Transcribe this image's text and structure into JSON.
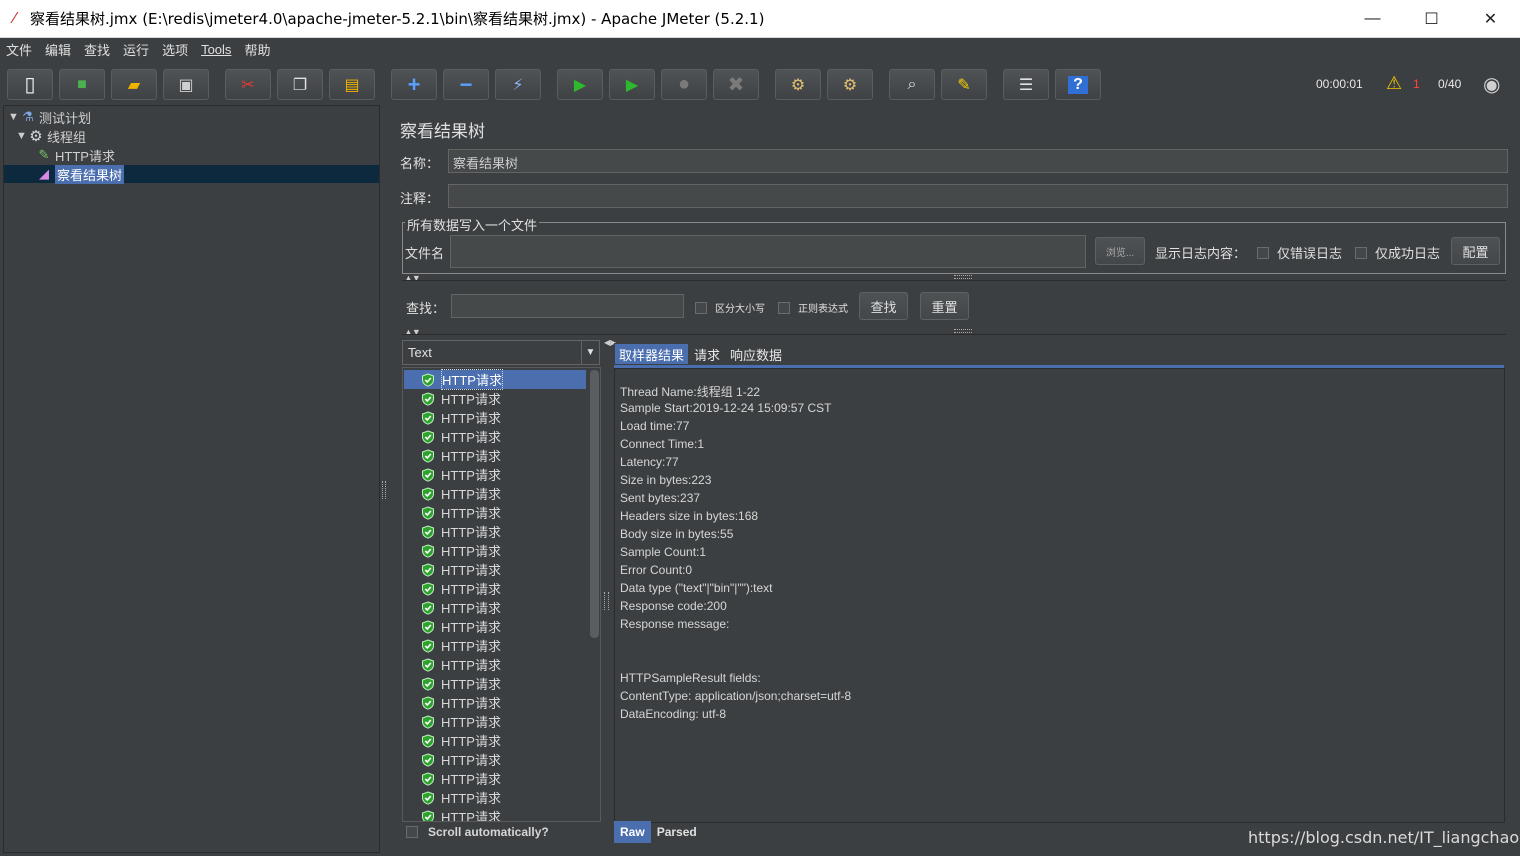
{
  "window": {
    "title": "察看结果树.jmx (E:\\redis\\jmeter4.0\\apache-jmeter-5.2.1\\bin\\察看结果树.jmx) - Apache JMeter (5.2.1)",
    "minimize": "—",
    "maximize": "☐",
    "close": "✕"
  },
  "menu": [
    "文件",
    "编辑",
    "查找",
    "运行",
    "选项",
    "Tools",
    "帮助"
  ],
  "toolbar": {
    "buttons": [
      {
        "name": "new-icon",
        "glyph": "▯",
        "color": "#f5f5f5"
      },
      {
        "name": "templates-icon",
        "glyph": "■",
        "color": "#4caf50"
      },
      {
        "name": "open-icon",
        "glyph": "▰",
        "color": "#f0b400"
      },
      {
        "name": "save-icon",
        "glyph": "▣",
        "color": "#cfcfcf"
      },
      {
        "name": "cut-icon",
        "glyph": "✂",
        "color": "#e53935"
      },
      {
        "name": "copy-icon",
        "glyph": "❐",
        "color": "#e0e0e0"
      },
      {
        "name": "paste-icon",
        "glyph": "▤",
        "color": "#f0b400"
      },
      {
        "name": "expand-icon",
        "glyph": "+",
        "color": "#5aa0ff"
      },
      {
        "name": "collapse-icon",
        "glyph": "−",
        "color": "#5aa0ff"
      },
      {
        "name": "toggle-icon",
        "glyph": "⚡",
        "color": "#8ab4f8"
      },
      {
        "name": "start-icon",
        "glyph": "▶",
        "color": "#2eb82e"
      },
      {
        "name": "start-no-timers-icon",
        "glyph": "▶",
        "color": "#2eb82e"
      },
      {
        "name": "stop-icon",
        "glyph": "●",
        "color": "#7a7a7a"
      },
      {
        "name": "shutdown-icon",
        "glyph": "✖",
        "color": "#7a7a7a"
      },
      {
        "name": "clear-icon",
        "glyph": "⚙",
        "color": "#e0c070"
      },
      {
        "name": "clear-all-icon",
        "glyph": "⚙",
        "color": "#e0c070"
      },
      {
        "name": "search-icon",
        "glyph": "⌕",
        "color": "#e0e0e0"
      },
      {
        "name": "reset-search-icon",
        "glyph": "✎",
        "color": "#f5d000"
      },
      {
        "name": "function-helper-icon",
        "glyph": "☰",
        "color": "#e0e0e0"
      },
      {
        "name": "help-icon",
        "glyph": "?",
        "color": "#5aa0ff"
      }
    ],
    "elapsed": "00:00:01",
    "warnings": "1",
    "threads": "0/40"
  },
  "tree": {
    "items": [
      {
        "label": "测试计划",
        "icon": "flask-icon"
      },
      {
        "label": "线程组",
        "icon": "gear-icon"
      },
      {
        "label": "HTTP请求",
        "icon": "pipette-icon"
      },
      {
        "label": "察看结果树",
        "icon": "chart-icon"
      }
    ]
  },
  "panel": {
    "heading": "察看结果树",
    "name_label": "名称：",
    "name_value": "察看结果树",
    "comment_label": "注释：",
    "comment_value": "",
    "group_title": "所有数据写入一个文件",
    "filename_label": "文件名",
    "filename_value": "",
    "browse_label": "浏览...",
    "log_label": "显示日志内容：",
    "errors_only_label": "仅错误日志",
    "success_only_label": "仅成功日志",
    "configure_label": "配置",
    "search_label": "查找：",
    "search_value": "",
    "case_label": "区分大小写",
    "regex_label": "正则表达式",
    "find_label": "查找",
    "reset_label": "重置"
  },
  "results": {
    "renderer": "Text",
    "items": [
      "HTTP请求",
      "HTTP请求",
      "HTTP请求",
      "HTTP请求",
      "HTTP请求",
      "HTTP请求",
      "HTTP请求",
      "HTTP请求",
      "HTTP请求",
      "HTTP请求",
      "HTTP请求",
      "HTTP请求",
      "HTTP请求",
      "HTTP请求",
      "HTTP请求",
      "HTTP请求",
      "HTTP请求",
      "HTTP请求",
      "HTTP请求",
      "HTTP请求",
      "HTTP请求",
      "HTTP请求",
      "HTTP请求",
      "HTTP请求"
    ],
    "scroll_auto_label": "Scroll automatically?"
  },
  "detail": {
    "tabs": [
      "取样器结果",
      "请求",
      "响应数据"
    ],
    "lines": [
      "Thread Name:线程组 1-22",
      "Sample Start:2019-12-24 15:09:57 CST",
      "Load time:77",
      "Connect Time:1",
      "Latency:77",
      "Size in bytes:223",
      "Sent bytes:237",
      "Headers size in bytes:168",
      "Body size in bytes:55",
      "Sample Count:1",
      "Error Count:0",
      "Data type (\"text\"|\"bin\"|\"\"):text",
      "Response code:200",
      "Response message:",
      "",
      "",
      "HTTPSampleResult fields:",
      "ContentType: application/json;charset=utf-8",
      "DataEncoding: utf-8"
    ],
    "bottom_tabs": [
      "Raw",
      "Parsed"
    ]
  },
  "watermark": "https://blog.csdn.net/IT_liangchaowei"
}
